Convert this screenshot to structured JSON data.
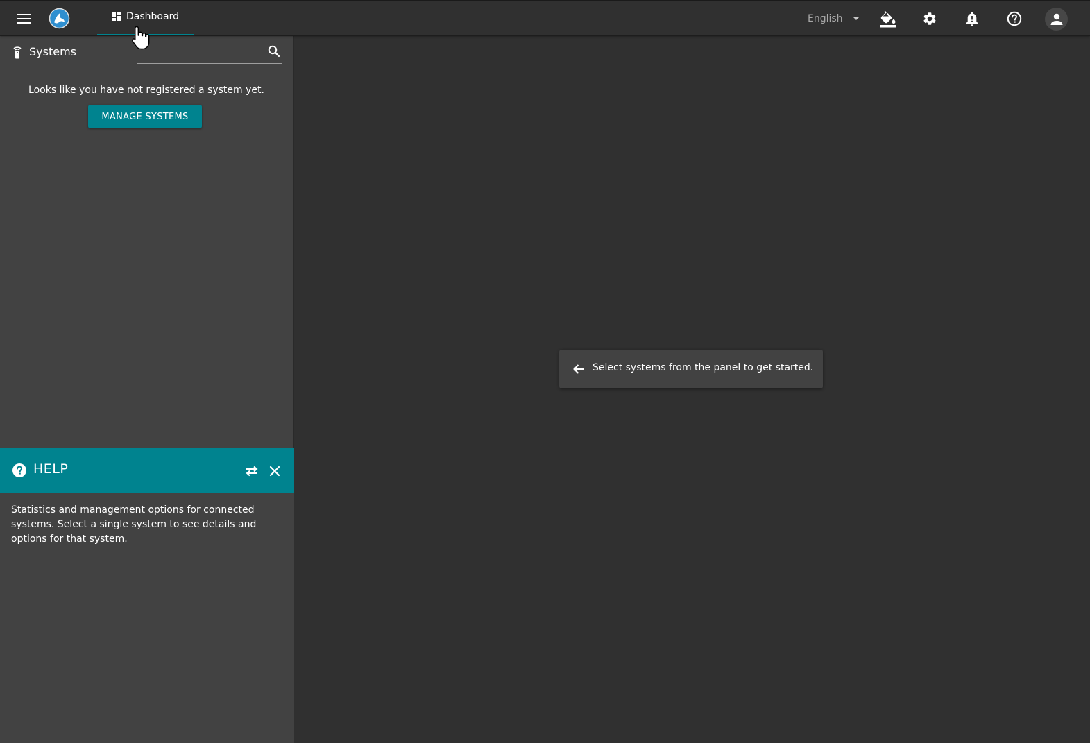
{
  "topbar": {
    "menu_icon": "menu-icon",
    "logo_icon": "app-logo",
    "tabs": [
      {
        "label": "Dashboard",
        "icon": "dashboard-icon",
        "active": true
      }
    ],
    "language": {
      "selected": "English"
    },
    "actions": [
      "paint-bucket-icon",
      "gear-icon",
      "bell-alert-icon",
      "help-circle-icon",
      "account-icon"
    ]
  },
  "sidebar": {
    "title": "Systems",
    "title_icon": "remote-icon",
    "search": {
      "value": "",
      "placeholder": ""
    },
    "empty_message": "Looks like you have not registered a system yet.",
    "manage_button": "MANAGE SYSTEMS"
  },
  "help": {
    "title": "HELP",
    "body": "Statistics and management options for connected systems. Select a single system to see details and options for that system."
  },
  "main": {
    "hint": "Select systems from the panel to get started."
  },
  "colors": {
    "accent": "#00838f",
    "topbar": "#303030",
    "sidebar": "#424242",
    "main": "#303030"
  }
}
